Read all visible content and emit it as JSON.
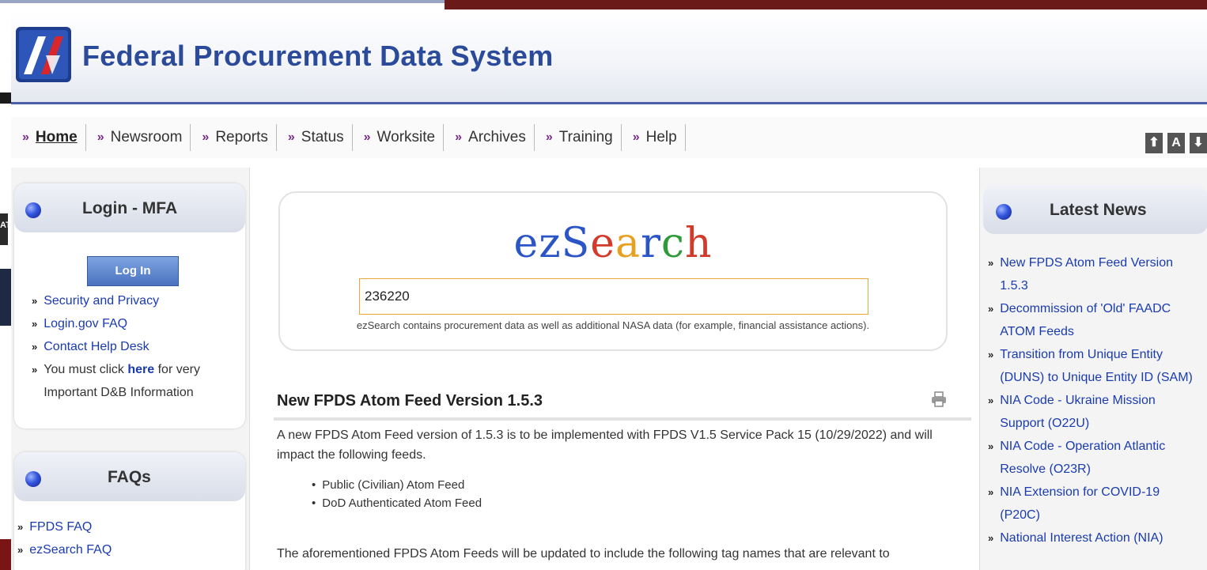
{
  "site": {
    "title": "Federal Procurement Data System"
  },
  "edge": {
    "left_fragment": "AT"
  },
  "nav": {
    "items": [
      {
        "label": "Home"
      },
      {
        "label": "Newsroom"
      },
      {
        "label": "Reports"
      },
      {
        "label": "Status"
      },
      {
        "label": "Worksite"
      },
      {
        "label": "Archives"
      },
      {
        "label": "Training"
      },
      {
        "label": "Help"
      }
    ],
    "chevron": "»"
  },
  "size_tools": {
    "up": "⬆",
    "font": "A",
    "down": "⬇"
  },
  "login": {
    "title": "Login - MFA",
    "button": "Log In",
    "links": [
      "Security and Privacy",
      "Login.gov FAQ",
      "Contact Help Desk"
    ],
    "notice_before": "You must click ",
    "notice_link": "here",
    "notice_after": " for very Important D&B Information"
  },
  "faqs": {
    "title": "FAQs",
    "links": [
      "FPDS FAQ",
      "ezSearch FAQ"
    ]
  },
  "ezsearch": {
    "logo": "ezSearch",
    "query": "236220",
    "note": "ezSearch contains procurement data as well as additional NASA data (for example, financial assistance actions)."
  },
  "article": {
    "title": "New FPDS Atom Feed Version 1.5.3",
    "p1": "A new FPDS Atom Feed version of 1.5.3 is to be implemented with FPDS V1.5 Service Pack 15 (10/29/2022) and will impact the following feeds.",
    "bullets": [
      "Public (Civilian) Atom Feed",
      "DoD Authenticated Atom Feed"
    ],
    "p2": "The aforementioned FPDS Atom Feeds will be updated to include the following tag names that are relevant to"
  },
  "news": {
    "title": "Latest News",
    "items": [
      "New FPDS Atom Feed Version 1.5.3",
      "Decommission of 'Old' FAADC ATOM Feeds",
      "Transition from Unique Entity (DUNS) to Unique Entity ID (SAM)",
      "NIA Code - Ukraine Mission Support (O22U)",
      "NIA Code - Operation Atlantic Resolve (O23R)",
      "NIA Extension for COVID-19 (P20C)",
      "National Interest Action (NIA)"
    ]
  },
  "colors": {
    "brand_blue": "#2b4a9a",
    "link": "#1a3bb0",
    "nav_chevron": "#7a2a8a",
    "search_border": "#e8a83a"
  }
}
